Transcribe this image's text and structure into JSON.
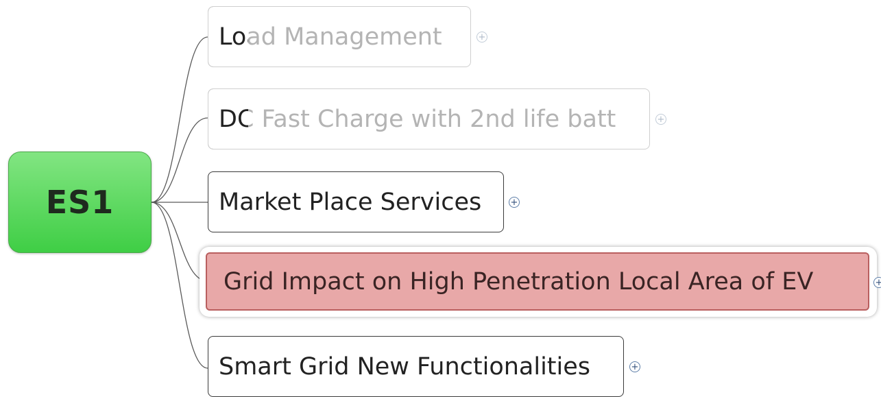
{
  "root": {
    "label": "ES1",
    "color": "#4cd150"
  },
  "topics": [
    {
      "label": "Load Management",
      "faded": true
    },
    {
      "label": "DC Fast Charge with 2nd life batt",
      "faded": true
    },
    {
      "label": "Market Place Services",
      "faded": false
    },
    {
      "label": "Grid Impact on High Penetration Local Area of EV",
      "faded": false,
      "selected": true,
      "selected_color": "#e8a8a8"
    },
    {
      "label": "Smart Grid New Functionalities",
      "faded": false
    }
  ],
  "expander_icon": "plus-circle-icon",
  "expander_glyph": "+"
}
